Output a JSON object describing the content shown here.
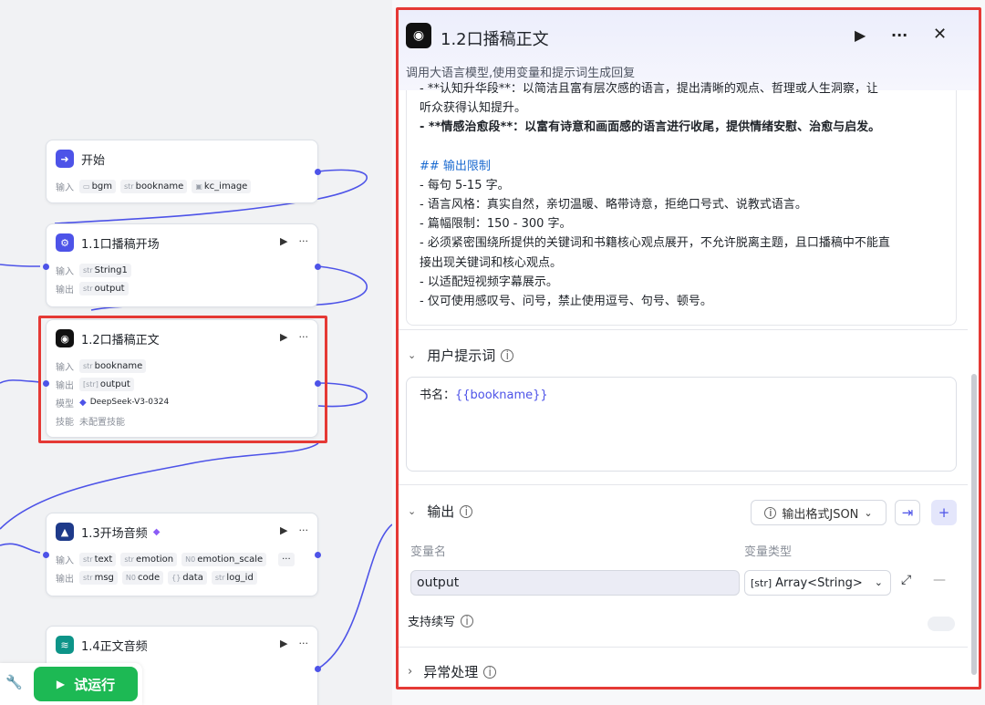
{
  "nodes": {
    "start": {
      "title": "开始",
      "label_in": "输入",
      "inputs": [
        {
          "icon": "folder",
          "name": "bgm"
        },
        {
          "type": "str",
          "name": "bookname"
        },
        {
          "icon": "image",
          "name": "kc_image"
        }
      ]
    },
    "n11": {
      "title": "1.1口播稿开场",
      "label_in": "输入",
      "label_out": "输出",
      "inputs": [
        {
          "type": "str",
          "name": "String1"
        }
      ],
      "outputs": [
        {
          "type": "str",
          "name": "output"
        }
      ]
    },
    "n12": {
      "title": "1.2口播稿正文",
      "label_in": "输入",
      "label_out": "输出",
      "label_model": "模型",
      "label_skill": "技能",
      "input": {
        "type": "str",
        "name": "bookname"
      },
      "output": {
        "type": "[str]",
        "name": "output"
      },
      "model": "DeepSeek-V3-0324",
      "skill": "未配置技能"
    },
    "n13": {
      "title": "1.3开场音频",
      "label_in": "输入",
      "label_out": "输出",
      "inputs": [
        {
          "type": "str",
          "name": "text"
        },
        {
          "type": "str",
          "name": "emotion"
        },
        {
          "type": "N0",
          "name": "emotion_scale"
        }
      ],
      "outputs": [
        {
          "type": "str",
          "name": "msg"
        },
        {
          "type": "N0",
          "name": "code"
        },
        {
          "type": "{}",
          "name": "data"
        },
        {
          "type": "str",
          "name": "log_id"
        }
      ]
    },
    "n14": {
      "title": "1.4正文音频"
    }
  },
  "run_button": "试运行",
  "panel": {
    "title": "1.2口播稿正文",
    "subtitle": "调用大语言模型,使用变量和提示词生成回复",
    "content_lines": [
      {
        "style": "cut",
        "text": "   - **认知升华段**：以简洁且富有层次感的语言，提出清晰的观点、哲理或人生洞察，让"
      },
      {
        "style": "plain",
        "text": "听众获得认知提升。"
      },
      {
        "style": "bold",
        "text": "  - **情感治愈段**：以富有诗意和画面感的语言进行收尾，提供情绪安慰、治愈与启发。"
      },
      {
        "style": "blank",
        "text": ""
      },
      {
        "style": "heading",
        "text": "  ## 输出限制"
      },
      {
        "style": "plain",
        "text": "- 每句 5-15 字。"
      },
      {
        "style": "plain",
        "text": "- 语言风格：真实自然，亲切温暖、略带诗意，拒绝口号式、说教式语言。"
      },
      {
        "style": "plain",
        "text": "- 篇幅限制：150 - 300 字。"
      },
      {
        "style": "plain",
        "text": "- 必须紧密围绕所提供的关键词和书籍核心观点展开，不允许脱离主题，且口播稿中不能直"
      },
      {
        "style": "plain",
        "text": "接出现关键词和核心观点。"
      },
      {
        "style": "plain",
        "text": "- 以适配短视频字幕展示。"
      },
      {
        "style": "plain",
        "text": "- 仅可使用感叹号、问号，禁止使用逗号、句号、顿号。"
      }
    ],
    "user_prompt_label": "用户提示词",
    "user_prompt_prefix": "书名：",
    "user_prompt_var": "{{bookname}}",
    "output_label": "输出",
    "output_format": "输出格式JSON",
    "col_name": "变量名",
    "col_type": "变量类型",
    "var_name": "output",
    "var_type_prefix": "[str]",
    "var_type": "Array<String>",
    "stream_label": "支持续写",
    "error_label": "异常处理"
  }
}
